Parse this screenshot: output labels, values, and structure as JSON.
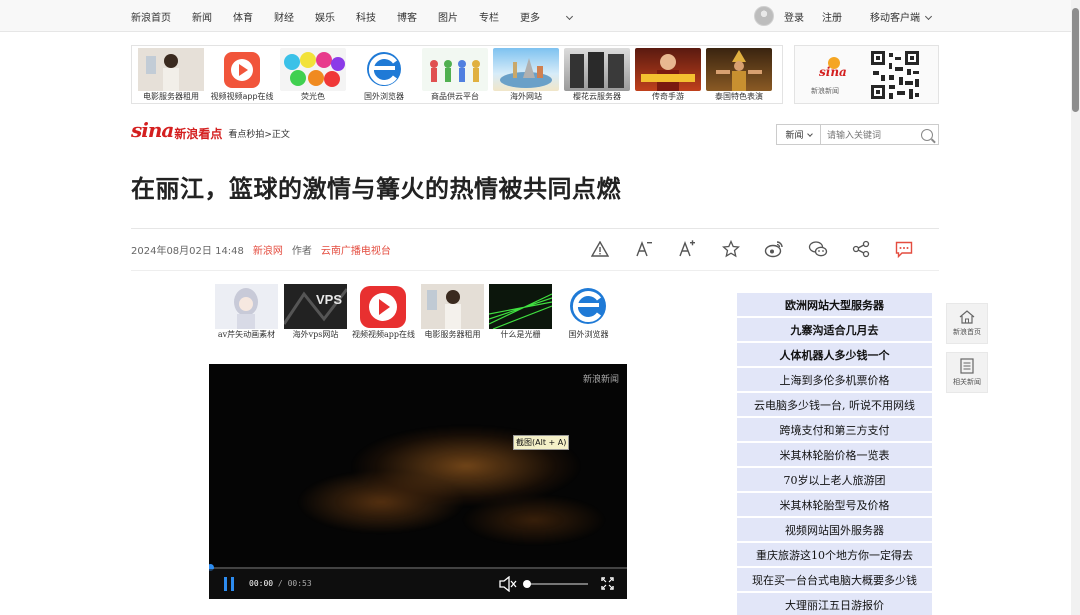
{
  "topnav": {
    "items": [
      "新浪首页",
      "新闻",
      "体育",
      "财经",
      "娱乐",
      "科技",
      "博客",
      "图片",
      "专栏",
      "更多"
    ],
    "login": "登录",
    "register": "注册",
    "client": "移动客户端"
  },
  "ads_top": [
    {
      "caption": "电影服务器租用"
    },
    {
      "caption": "视频视频app在线"
    },
    {
      "caption": "荧光色"
    },
    {
      "caption": "国外浏览器"
    },
    {
      "caption": "商品供云平台"
    },
    {
      "caption": "海外网站"
    },
    {
      "caption": "樱花云服务器"
    },
    {
      "caption": "传奇手游"
    },
    {
      "caption": "泰国特色表演"
    }
  ],
  "qr": {
    "caption": "新浪新闻"
  },
  "brand": {
    "logo": "sina",
    "name": "新浪看点",
    "crumb": "看点秒拍>正文"
  },
  "search": {
    "select": "新闻",
    "placeholder": "请输入关键词"
  },
  "article": {
    "title": "在丽江，篮球的激情与篝火的热情被共同点燃",
    "date": "2024年08月02日 14:48",
    "source": "新浪网",
    "author_label": "作者",
    "author": "云南广播电视台"
  },
  "ads_inner": [
    {
      "caption": "av芹矢动画素材"
    },
    {
      "caption": "海外vps网站"
    },
    {
      "caption": "视频视频app在线"
    },
    {
      "caption": "电影服务器租用"
    },
    {
      "caption": "什么是光栅"
    },
    {
      "caption": "国外浏览器"
    }
  ],
  "video": {
    "watermark": "新浪新闻",
    "tooltip": "截图(Alt + A)",
    "current": "00:00",
    "duration": "00:53",
    "progress_fraction": 0.0,
    "volume_fraction": 0.0
  },
  "related": [
    {
      "text": "欧洲网站大型服务器",
      "bold": true
    },
    {
      "text": "九寨沟适合几月去",
      "bold": true
    },
    {
      "text": "人体机器人多少钱一个",
      "bold": true
    },
    {
      "text": "上海到多伦多机票价格",
      "bold": false
    },
    {
      "text": "云电脑多少钱一台, 听说不用网线",
      "bold": false
    },
    {
      "text": "跨境支付和第三方支付",
      "bold": false
    },
    {
      "text": "米其林轮胎价格一览表",
      "bold": false
    },
    {
      "text": "70岁以上老人旅游团",
      "bold": false
    },
    {
      "text": "米其林轮胎型号及价格",
      "bold": false
    },
    {
      "text": "视频网站国外服务器",
      "bold": false
    },
    {
      "text": "重庆旅游这10个地方你一定得去",
      "bold": false
    },
    {
      "text": "现在买一台台式电脑大概要多少钱",
      "bold": false
    },
    {
      "text": "大理丽江五日游报价",
      "bold": false
    }
  ],
  "side": {
    "home": "新浪首页",
    "related": "相关新闻"
  }
}
